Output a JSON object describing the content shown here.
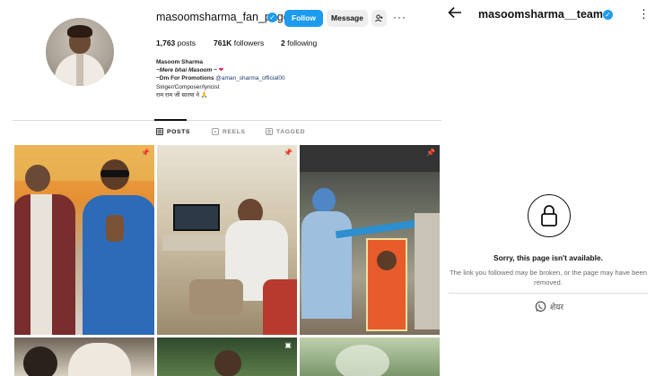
{
  "profile": {
    "username": "masoomsharma_fan_page",
    "follow_label": "Follow",
    "message_label": "Message",
    "more_label": "···",
    "stats": {
      "posts_count": "1,763",
      "posts_label": "posts",
      "followers_count": "761K",
      "followers_label": "followers",
      "following_count": "2",
      "following_label": "following"
    },
    "bio": {
      "name": "Masoom Sharma",
      "line1": "~Mere bhai Masoom ~",
      "line1_emoji": "❤",
      "line2_prefix": "~Dm For Promotions",
      "line2_handle": "@aman_sharma_official00",
      "line3": "Singer/Composer/lyricist",
      "line4": "राम राम जी सारया ने 🙏"
    },
    "tabs": [
      {
        "label": "POSTS",
        "icon": "grid-icon"
      },
      {
        "label": "REELS",
        "icon": "reels-icon"
      },
      {
        "label": "TAGGED",
        "icon": "tag-icon"
      }
    ]
  },
  "team_page": {
    "username": "masoomsharma__team",
    "title": "Sorry, this page isn't available.",
    "message": "The link you followed may be broken, or the page may have been removed.",
    "share_label": "शेयर",
    "share_icon": "whatsapp-icon"
  },
  "colors": {
    "accent": "#1d9bf0",
    "muted": "#888888"
  }
}
